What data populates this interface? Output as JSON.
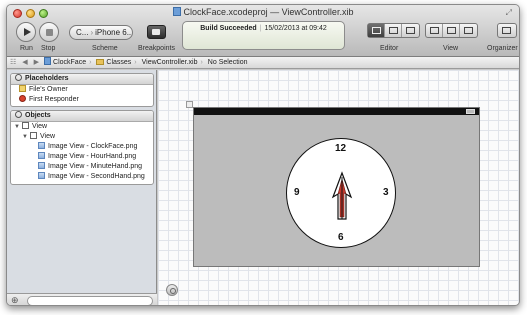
{
  "window": {
    "title": "ClockFace.xcodeproj — ",
    "file_title": "ViewController.xib"
  },
  "toolbar": {
    "run_label": "Run",
    "stop_label": "Stop",
    "scheme_target": "C...",
    "scheme_device": "iPhone 6....",
    "scheme_label": "Scheme",
    "breakpoints_label": "Breakpoints",
    "status_main": "Build Succeeded",
    "status_time": "15/02/2013 at 09:42",
    "editor_label": "Editor",
    "view_label": "View",
    "organizer_label": "Organizer"
  },
  "jumpbar": {
    "crumbs": [
      "ClockFace",
      "Classes",
      "ViewController.xib",
      "No Selection"
    ]
  },
  "placeholders": {
    "title": "Placeholders",
    "items": [
      "File's Owner",
      "First Responder"
    ]
  },
  "objects": {
    "title": "Objects",
    "root": "View",
    "child": "View",
    "items": [
      "Image View - ClockFace.png",
      "Image View - HourHand.png",
      "Image View - MinuteHand.png",
      "Image View - SecondHand.png"
    ]
  },
  "clock": {
    "n12": "12",
    "n3": "3",
    "n6": "6",
    "n9": "9"
  },
  "colors": {
    "hand_fill": "#c23a2e",
    "canvas_grid": "#e1e4ea"
  },
  "icons": {
    "run": "play-icon",
    "stop": "stop-icon",
    "zoom": "zoom-icon"
  }
}
